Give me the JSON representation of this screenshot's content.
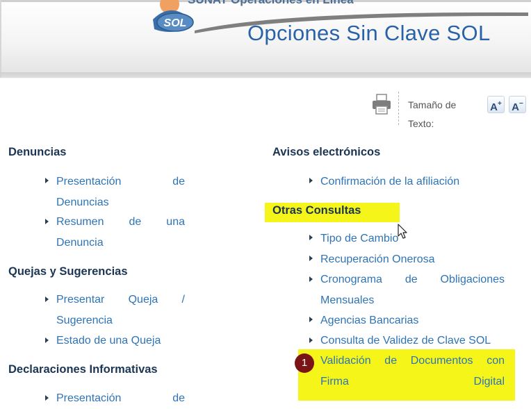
{
  "banner": {
    "top_cut_text": "SUNAT Operaciones en Línea",
    "logo_text": "SOL",
    "title": "Opciones Sin Clave SOL"
  },
  "tools": {
    "text_size_label": "Tamaño de Texto:",
    "increase_label": "A",
    "increase_sup": "+",
    "decrease_label": "A",
    "decrease_sup": "−"
  },
  "left": {
    "denuncias": {
      "heading": "Denuncias",
      "items": [
        {
          "line1": "Presentación de",
          "line2": "Denuncias"
        },
        {
          "line1": "Resumen de una",
          "line2": "Denuncia"
        }
      ]
    },
    "quejas": {
      "heading": "Quejas y Sugerencias",
      "items": [
        {
          "line1": "Presentar Queja /",
          "line2": "Sugerencia"
        },
        {
          "line1": "Estado de una Queja"
        }
      ]
    },
    "declaraciones": {
      "heading": "Declaraciones Informativas",
      "items": [
        {
          "line1": "Presentación de"
        }
      ]
    }
  },
  "right": {
    "avisos": {
      "heading": "Avisos electrónicos",
      "items": [
        {
          "line1": "Confirmación de la afiliación"
        }
      ]
    },
    "otras": {
      "heading": "Otras Consultas",
      "items": [
        {
          "line1": "Tipo de Cambio"
        },
        {
          "line1": "Recuperación Onerosa"
        },
        {
          "line1": "Cronograma de Obligaciones",
          "line2": "Mensuales"
        },
        {
          "line1": "Agencias Bancarias"
        },
        {
          "line1": "Consulta de Validez de Clave SOL"
        },
        {
          "line1": "Validación de Documentos con",
          "line2": "Firma Digital"
        }
      ]
    }
  },
  "annotation": {
    "badge": "1",
    "color": "#7b1416"
  },
  "colors": {
    "highlight": "#f5f51a",
    "link": "#2e74b5",
    "heading": "#1b3553",
    "title": "#2a62a8"
  }
}
